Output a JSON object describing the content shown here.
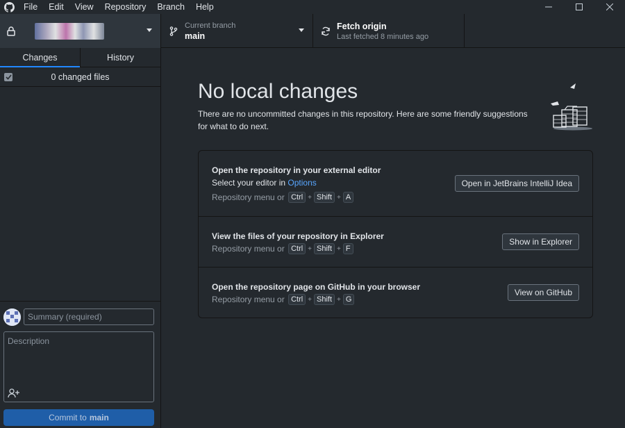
{
  "menu": {
    "items": [
      "File",
      "Edit",
      "View",
      "Repository",
      "Branch",
      "Help"
    ]
  },
  "toolbar": {
    "branch_label": "Current branch",
    "branch_value": "main",
    "fetch_label": "Fetch origin",
    "fetch_status": "Last fetched 8 minutes ago"
  },
  "sidebar": {
    "tabs": [
      "Changes",
      "History"
    ],
    "changed_files": "0 changed files"
  },
  "commit": {
    "summary_placeholder": "Summary (required)",
    "description_placeholder": "Description",
    "button_prefix": "Commit to",
    "button_branch": "main"
  },
  "main": {
    "title": "No local changes",
    "subtitle": "There are no uncommitted changes in this repository. Here are some friendly suggestions for what to do next.",
    "suggestions": [
      {
        "title": "Open the repository in your external editor",
        "desc_prefix": "Select your editor in",
        "desc_link": "Options",
        "shortcut_prefix": "Repository menu or",
        "keys": [
          "Ctrl",
          "Shift",
          "A"
        ],
        "button": "Open in JetBrains IntelliJ Idea"
      },
      {
        "title": "View the files of your repository in Explorer",
        "shortcut_prefix": "Repository menu or",
        "keys": [
          "Ctrl",
          "Shift",
          "F"
        ],
        "button": "Show in Explorer"
      },
      {
        "title": "Open the repository page on GitHub in your browser",
        "shortcut_prefix": "Repository menu or",
        "keys": [
          "Ctrl",
          "Shift",
          "G"
        ],
        "button": "View on GitHub"
      }
    ]
  },
  "icons": {
    "app": "github-icon",
    "lock": "lock-icon",
    "branch": "git-branch-icon",
    "fetch": "sync-icon",
    "coauthor": "person-add-icon"
  },
  "colors": {
    "accent": "#2188ff",
    "link": "#58a6ff",
    "commit_button": "#1f5ea8",
    "background": "#24292e"
  }
}
